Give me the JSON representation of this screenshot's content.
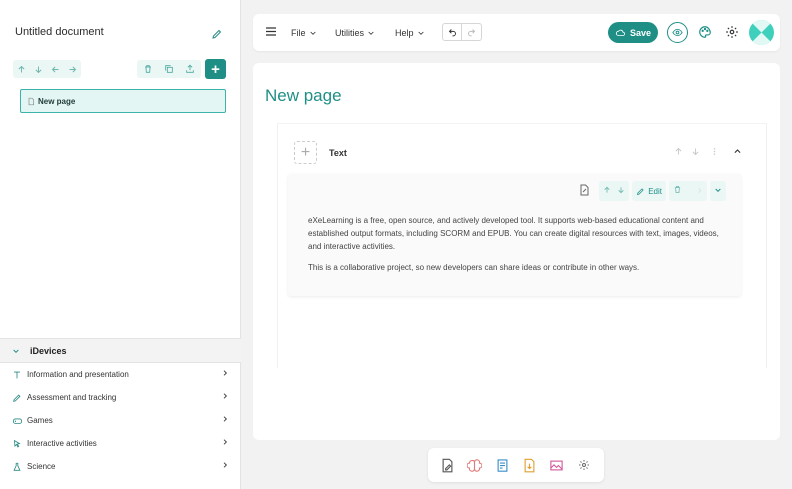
{
  "sidebar": {
    "doc_title": "Untitled document",
    "pages": [
      {
        "label": "New page"
      }
    ],
    "idevices": {
      "header": "iDevices",
      "categories": [
        {
          "label": "Information and presentation",
          "icon": "text-icon"
        },
        {
          "label": "Assessment and tracking",
          "icon": "pencil-icon"
        },
        {
          "label": "Games",
          "icon": "gamepad-icon"
        },
        {
          "label": "Interactive activities",
          "icon": "pointer-icon"
        },
        {
          "label": "Science",
          "icon": "flask-icon"
        }
      ]
    }
  },
  "topbar": {
    "menus": [
      "File",
      "Utilities",
      "Help"
    ],
    "save_label": "Save"
  },
  "main": {
    "page_title": "New page",
    "block": {
      "title": "Text",
      "edit_label": "Edit",
      "paragraphs": [
        "eXeLearning is a free, open source, and actively developed tool. It supports web-based educational content and established output formats, including SCORM and EPUB. You can create digital resources with text, images, videos, and interactive activities.",
        "This is a collaborative project, so new developers can share ideas or contribute in other ways."
      ]
    }
  },
  "colors": {
    "accent": "#1f8f86",
    "accent_light": "#eaf7f5",
    "selected_bg": "#e3f6f3"
  }
}
